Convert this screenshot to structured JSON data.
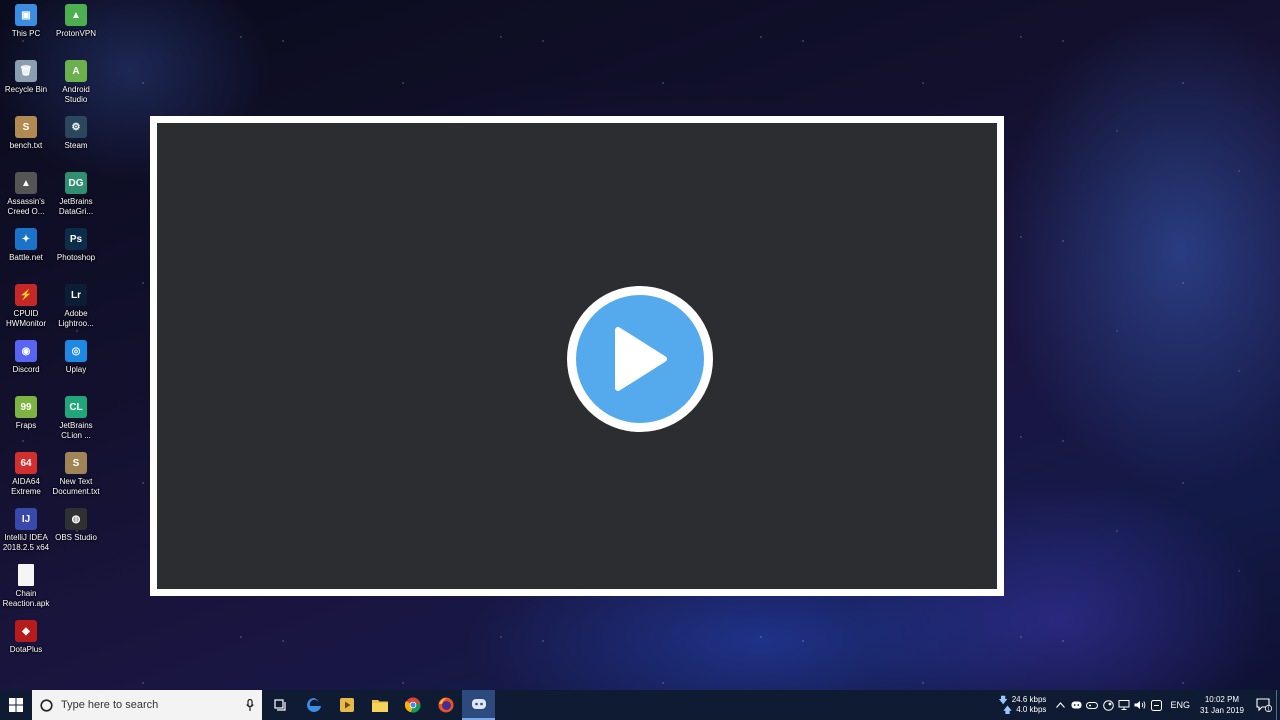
{
  "desktop": {
    "icons": [
      {
        "label": "This PC",
        "color": "#3a8de0",
        "glyph": "▣"
      },
      {
        "label": "ProtonVPN",
        "color": "#4caf50",
        "glyph": "▲"
      },
      {
        "label": "Recycle Bin",
        "color": "#8aa0b0",
        "glyph": "🗑"
      },
      {
        "label": "Android\nStudio",
        "color": "#6ab04c",
        "glyph": "A"
      },
      {
        "label": "bench.txt",
        "color": "#b08a50",
        "glyph": "S"
      },
      {
        "label": "Steam",
        "color": "#2a475e",
        "glyph": "⚙"
      },
      {
        "label": "Assassin's\nCreed O...",
        "color": "#555555",
        "glyph": "▲"
      },
      {
        "label": "JetBrains\nDataGri...",
        "color": "#2f8f6f",
        "glyph": "DG"
      },
      {
        "label": "Battle.net",
        "color": "#1a73c8",
        "glyph": "✦"
      },
      {
        "label": "Photoshop",
        "color": "#0c2d4a",
        "glyph": "Ps"
      },
      {
        "label": "CPUID\nHWMonitor",
        "color": "#c62828",
        "glyph": "⚡"
      },
      {
        "label": "Adobe\nLightroo...",
        "color": "#0b1e33",
        "glyph": "Lr"
      },
      {
        "label": "Discord",
        "color": "#5865f2",
        "glyph": "◉"
      },
      {
        "label": "Uplay",
        "color": "#1e88e5",
        "glyph": "◎"
      },
      {
        "label": "Fraps",
        "color": "#7cb342",
        "glyph": "99"
      },
      {
        "label": "JetBrains\nCLion ...",
        "color": "#21a67a",
        "glyph": "CL"
      },
      {
        "label": "AIDA64\nExtreme",
        "color": "#d32f2f",
        "glyph": "64"
      },
      {
        "label": "New Text\nDocument.txt",
        "color": "#a08458",
        "glyph": "S"
      },
      {
        "label": "IntelliJ IDEA\n2018.2.5 x64",
        "color": "#3949ab",
        "glyph": "IJ"
      },
      {
        "label": "OBS Studio",
        "color": "#303030",
        "glyph": "◍"
      },
      {
        "label": "Chain\nReaction.apk",
        "color": "#f5f5f5",
        "glyph": ""
      },
      {
        "label": "",
        "color": "",
        "glyph": ""
      },
      {
        "label": "DotaPlus",
        "color": "#b71c1c",
        "glyph": "◆"
      }
    ]
  },
  "player": {
    "play_icon": "play-icon",
    "accent": "#55aaee"
  },
  "taskbar": {
    "search_placeholder": "Type here to search",
    "pinned": [
      {
        "name": "task-view",
        "icon": "task-view-icon"
      },
      {
        "name": "edge",
        "icon": "edge-icon"
      },
      {
        "name": "media-player",
        "icon": "media-player-icon"
      },
      {
        "name": "file-explorer",
        "icon": "folder-icon"
      },
      {
        "name": "chrome",
        "icon": "chrome-icon"
      },
      {
        "name": "firefox",
        "icon": "firefox-icon"
      },
      {
        "name": "discord",
        "icon": "discord-icon"
      }
    ],
    "net_down": "24.6 kbps",
    "net_up": "4.0 kbps",
    "language": "ENG",
    "time": "10:02 PM",
    "date": "31 Jan 2019",
    "notification_count": "1"
  }
}
